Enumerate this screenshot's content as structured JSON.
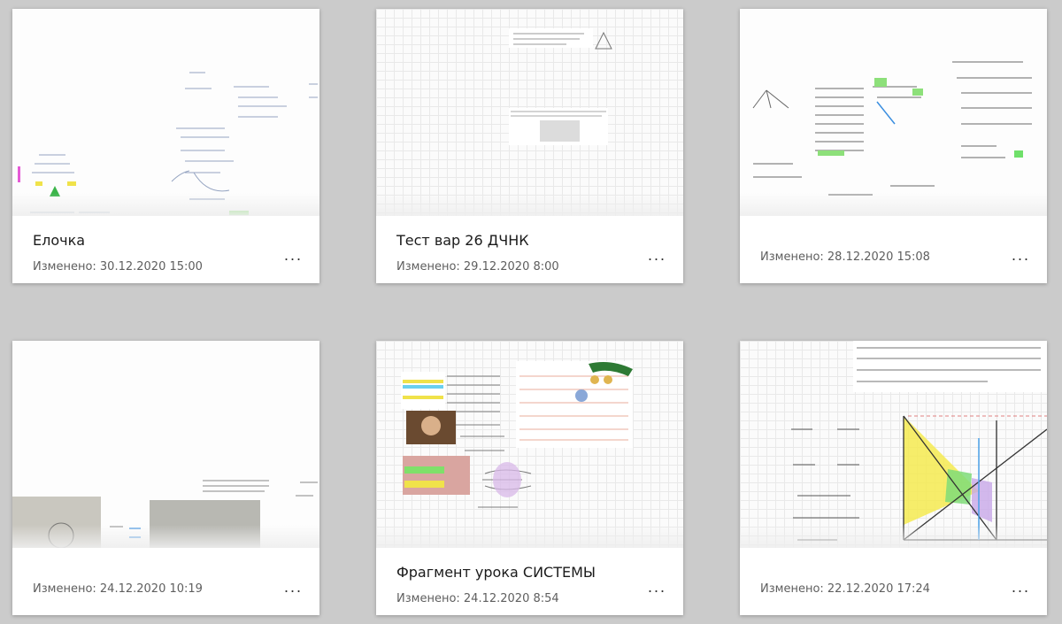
{
  "colors": {
    "background": "#cbcbcb",
    "card": "#ffffff",
    "title": "#1b1b1b",
    "meta": "#5e5e5e"
  },
  "more_icon": "ellipsis-icon",
  "cards": [
    {
      "title": "Елочка",
      "modified": "Изменено: 30.12.2020 15:00",
      "more": "···"
    },
    {
      "title": "Тест вар 26 ДЧНК",
      "modified": "Изменено: 29.12.2020 8:00",
      "more": "···"
    },
    {
      "title": "",
      "modified": "Изменено: 28.12.2020 15:08",
      "more": "···"
    },
    {
      "title": "",
      "modified": "Изменено: 24.12.2020 10:19",
      "more": "···"
    },
    {
      "title": "Фрагмент урока СИСТЕМЫ",
      "modified": "Изменено: 24.12.2020 8:54",
      "more": "···"
    },
    {
      "title": "",
      "modified": "Изменено: 22.12.2020 17:24",
      "more": "···"
    }
  ]
}
